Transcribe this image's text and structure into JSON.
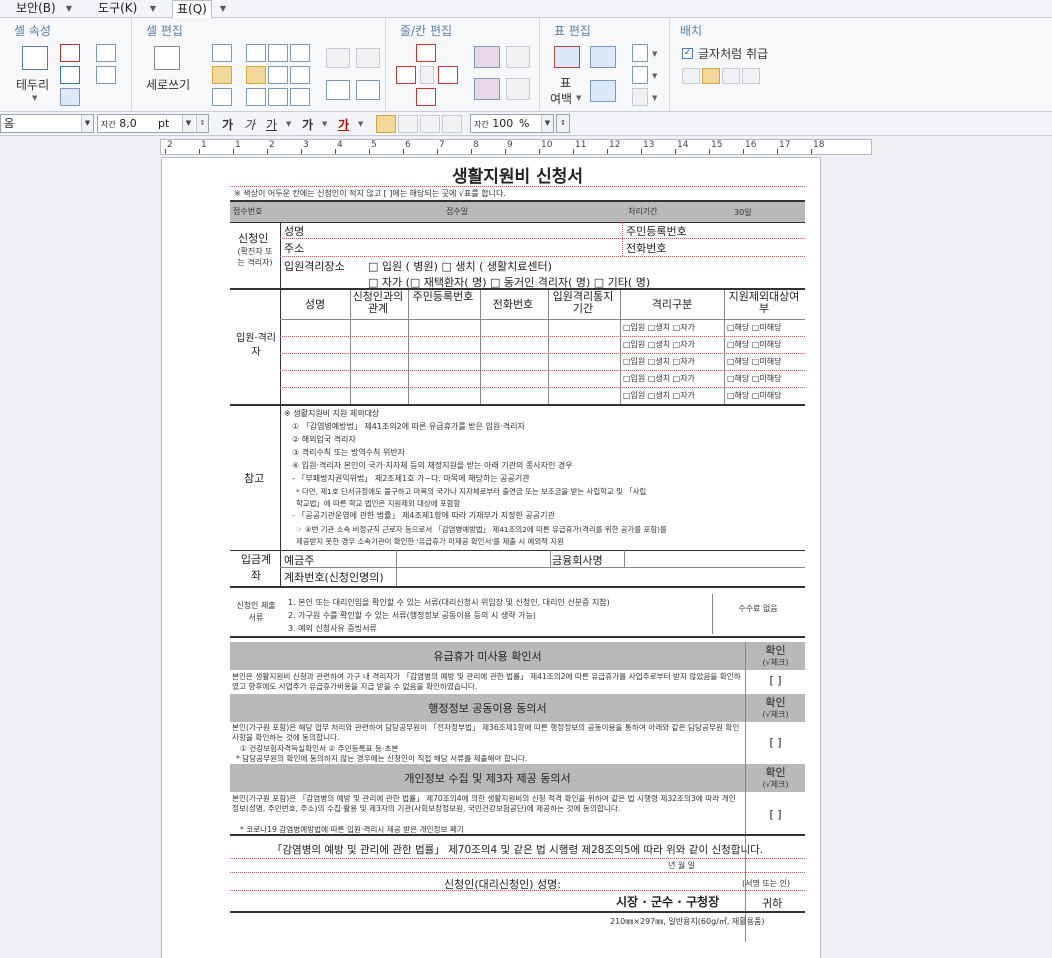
{
  "menubar": {
    "items": [
      "보안(B)",
      "도구(K)",
      "표(Q)"
    ]
  },
  "ribbon": {
    "cell_attr": {
      "title": "셀 속성",
      "border_label": "테두리"
    },
    "cell_edit": {
      "title": "셀 편집",
      "vertical_label": "세로쓰기"
    },
    "row_col": {
      "title": "줄/칸 편집"
    },
    "table_edit": {
      "title": "표 편집",
      "margin_label_1": "표",
      "margin_label_2": "여백"
    },
    "arrange": {
      "title": "배치",
      "treat_as_char": "글자처럼 취급"
    }
  },
  "format": {
    "style": "옴",
    "size_icon": "자간",
    "font_size": "8,0",
    "unit": "pt",
    "bold": "가",
    "italic": "가",
    "underline": "가",
    "strike": "가",
    "color": "가",
    "ratio_label": "자간",
    "ratio": "100",
    "percent": "%"
  },
  "ruler": {
    "numbers": [
      "2",
      "1",
      "1",
      "2",
      "3",
      "4",
      "5",
      "6",
      "7",
      "8",
      "9",
      "10",
      "11",
      "12",
      "13",
      "14",
      "15",
      "16",
      "17",
      "18"
    ]
  },
  "form": {
    "title": "생활지원비 신청서",
    "note": "※ 색상이 어두운 칸에는 신청인이 적지 않고 [ ]에는 해당되는 곳에 √표를 합니다.",
    "receipt_no": "접수번호",
    "receipt_date": "접수일",
    "proc_period": "처리기간",
    "proc_days": "30일",
    "applicant": "신청인",
    "applicant_sub": "(확진자 또는 격리자)",
    "name": "성명",
    "rrn": "주민등록번호",
    "address": "주소",
    "phone": "전화번호",
    "iso_place": "입원격리장소",
    "iso_line1": "□ 입원 (          병원)     □ 생치 (          생활치료센터)",
    "iso_line2": "□ 자가 (□ 재택환자(     명)  □ 동거인 격리자(     명)  □ 기타(     명)",
    "table_side": "입원·격리자",
    "cols": [
      "성명",
      "신청인과의 관계",
      "주민등록번호",
      "전화번호",
      "입원격리통지기간",
      "격리구분",
      "지원제외대상여부"
    ],
    "iso_cell": "□입원 □생치 □자가",
    "excl_cell": "□해당  □미해당",
    "ref_side": "참고",
    "ref_lines": [
      "※ 생활지원비 지원 제외대상",
      "① 「감염병예방법」 제41조의2에 따른 유급휴가를 받은 입원·격리자",
      "② 해외입국 격리자",
      "③ 격리수칙 또는 방역수칙 위반자",
      "④ 입원·격리자 본인이 국가·지자체 등의 재정지원을 받는 아래 기관의 종사자인 경우",
      "  - 「부패방지권익위법」 제2조제1호 가~다. 마목에 해당하는 공공기관",
      "   * 다만, 제1호 단서규정에도 불구하고 마목의 국가나 지자체로부터 출연금 또는 보조금을 받는 사립학교 및 「사립",
      "     학교법」에 따른 학교 법인은 지원제외 대상에 포함함",
      "  - 「공공기관운영에 관한 법률」 제4조제1항에 따라 기재부가 지정한 공공기관",
      "   ☞ ④번 기관 소속 비정규직 근로자 등으로서 「감염병예방법」 제41조의2에 따른 유급휴가(격리를 위한 공가를 포함)를",
      "     제공받지 못한 경우 소속기관이 확인한 '유급휴가 미제공 확인서'를 제출 시 예외적 지원"
    ],
    "bank_side": "입금계좌",
    "depositor": "예금주",
    "bank": "금융회사명",
    "account": "계좌번호(신청인명의)",
    "docs_side": "신청인 제출서류",
    "docs": [
      "1. 본인 또는 대리인임을 확인할 수 있는 서류(대리신청시 위임장 및 신청인, 대리인 신분증 지참)",
      "2. 가구원 수를 확인할 수 있는 서류(행정정보 공동이용 등의 시 생략 가능)",
      "3. 예외 신청사유 증빙서류"
    ],
    "fee": "수수료 없음",
    "sec1_title": "유급휴가 미사용 확인서",
    "confirm": "확인",
    "check": "(√체크)",
    "sec1_body": "본인은 생활지원비 신청과 관련하여 가구 내 격리자가 「감염병의 예방 및 관리에 관한 법률」 제41조의2에 따른 유급휴가를 사업주로부터 받지 않았음을 확인하였고 향후에도 사업주가 유급휴가비용을 지급 받을 수 없음을 확인하였습니다.",
    "bracket": "[    ]",
    "sec2_title": "행정정보 공동이용 동의서",
    "sec2_body": "본인(가구원 포함)은 해당 업무 처리와 관련하여 담당공무원이 「전자정부법」 제36조제1항에 따른 행정정보의 공동이용을 통하여 아래와 같은 담당공무원 확인사항을 확인하는 것에 동의합니다.",
    "sec2_items": "① 건강보험자격득실확인서                     ② 주민등록표 등·초본",
    "sec2_note": "* 담당공무원의 확인에 동의하지 않는 경우에는 신청인이 직접 해당 서류를 제출해야 합니다.",
    "sec3_title": "개인정보 수집 및 제3자 제공 동의서",
    "sec3_body": "본인(가구원 포함)은 「감염병의 예방 및 관리에 관한 법률」 제70조의4에 의한 생활지원비의 신청 적격 확인을 위하여 같은 법 시행령 제32조의3에 따라 개인정보(성명, 주민번호, 주소)의 수집·활용 및 제3자의 기관(사회보장정보원, 국민건강보험공단)에 제공하는 것에 동의합니다.",
    "sec3_note": "* 코로나19 감염병예방법에 따른 입원·격리시 제공 받은 개인정보 폐기",
    "declaration": "「감염병의 예방 및 관리에 관한 법률」 제70조의4 및 같은 법 시행령 제28조의5에 따라 위와 같이 신청합니다.",
    "date_line": "년        월        일",
    "signer": "신청인(대리신청인) 성명:",
    "sign_note": "(서명 또는 인)",
    "addressee": "시장 · 군수 · 구청장",
    "honorific": "귀하",
    "paper": "210㎜×297㎜, 일반용지(60g/㎡, 재활용품)"
  }
}
